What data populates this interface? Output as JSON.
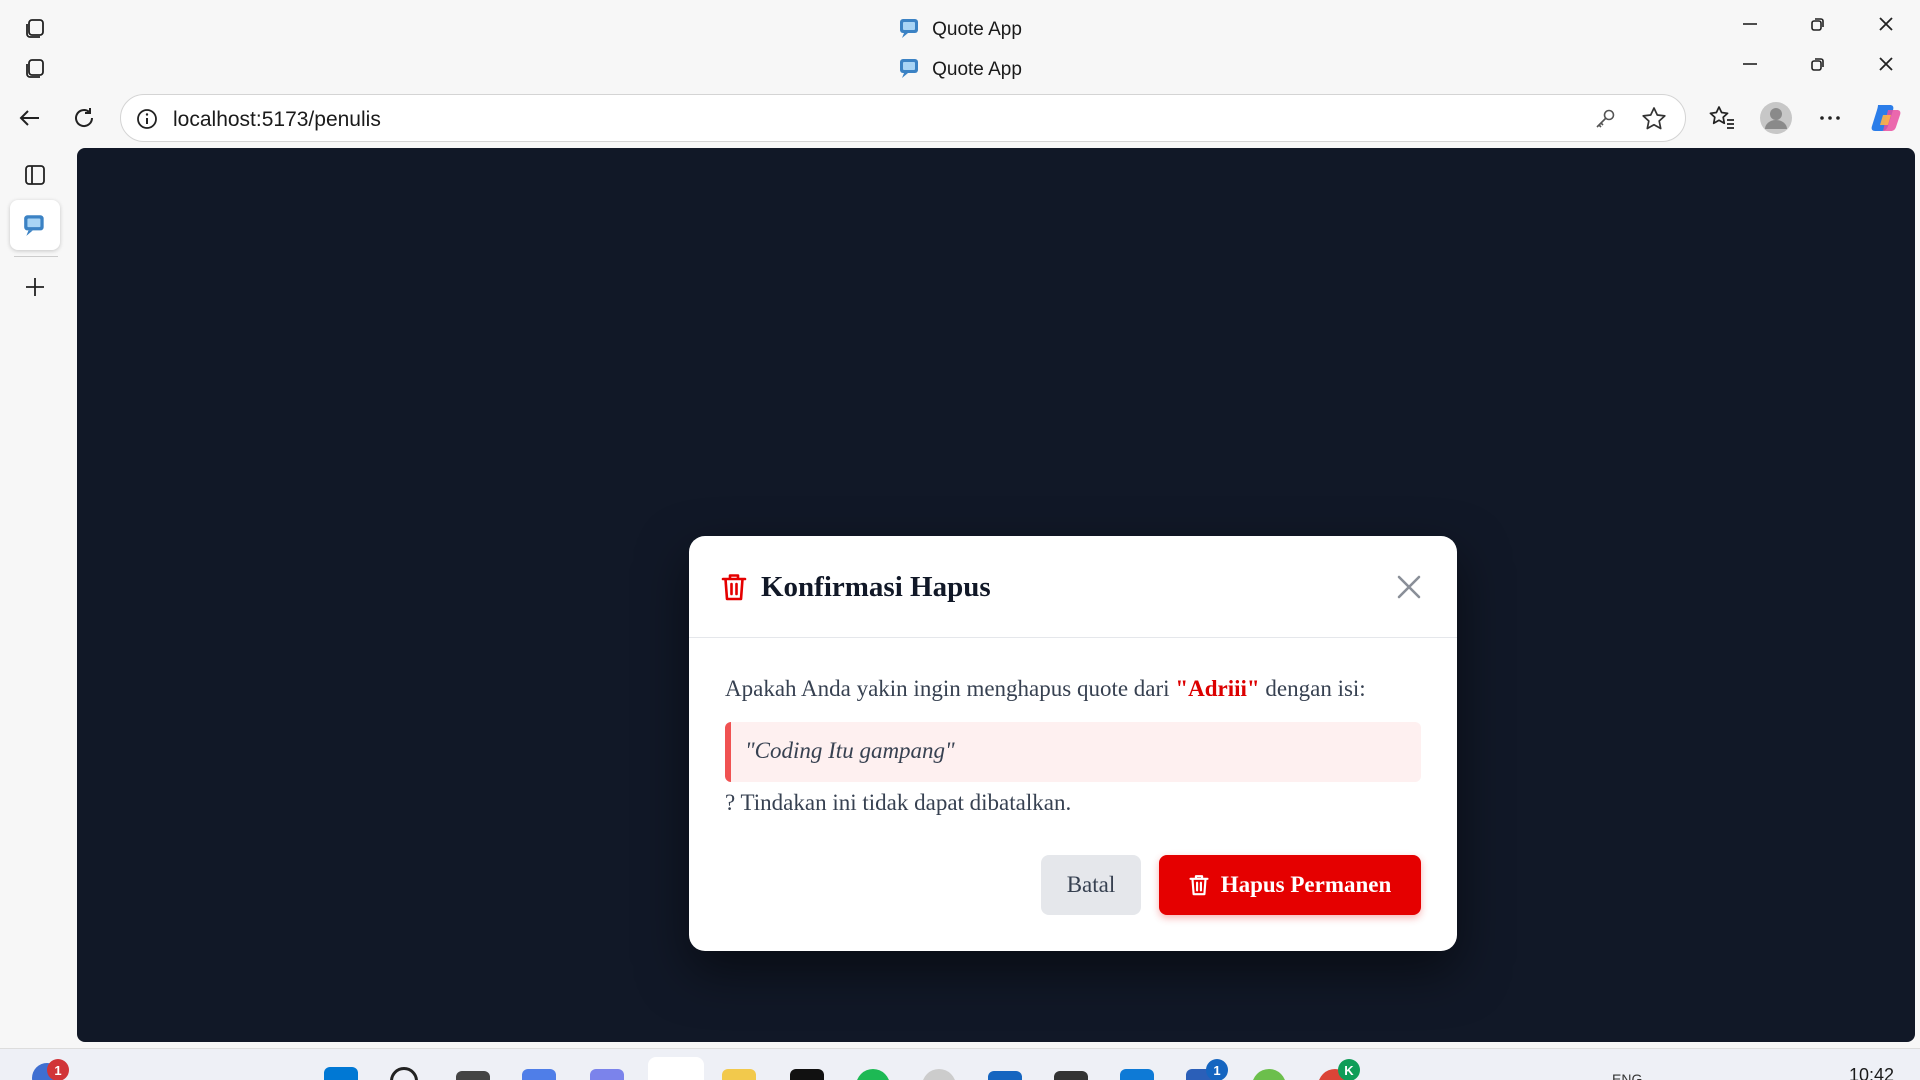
{
  "window": {
    "title_1": "Quote App",
    "title_2": "Quote App"
  },
  "browser": {
    "url": "localhost:5173/penulis"
  },
  "dialog": {
    "title": "Konfirmasi Hapus",
    "message_prefix": "Apakah Anda yakin ingin menghapus quote dari ",
    "author": "\"Adriii\"",
    "message_suffix": " dengan isi:",
    "quote": "\"Coding Itu gampang\"",
    "warning": "? Tindakan ini tidak dapat dibatalkan.",
    "cancel_label": "Batal",
    "confirm_label": "Hapus Permanen"
  },
  "taskbar": {
    "notification_count": "1",
    "word_badge": "1",
    "chrome_badge": "K",
    "lang": "ENG",
    "time": "10:42"
  },
  "colors": {
    "danger": "#e50000",
    "viewport_bg": "#111827",
    "quote_bg": "#fef0f0",
    "quote_border": "#f05252"
  }
}
